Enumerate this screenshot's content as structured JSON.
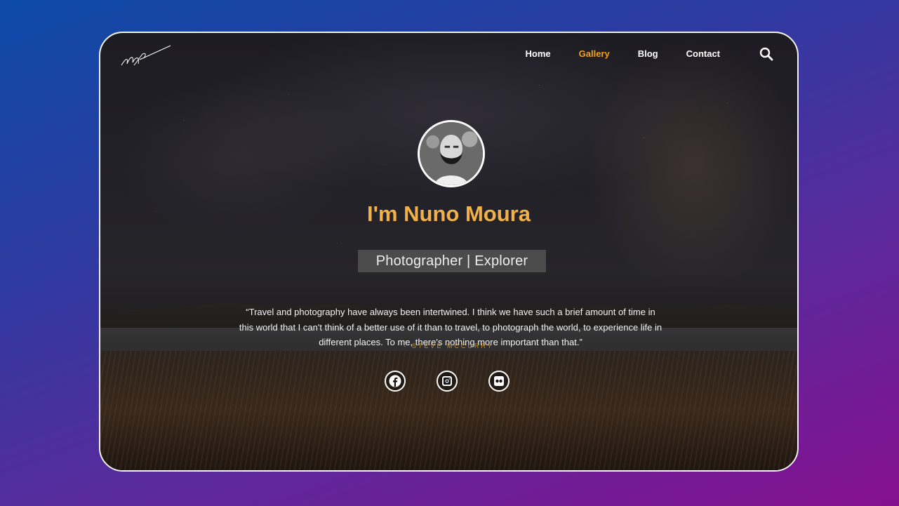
{
  "header": {
    "nav": [
      {
        "label": "Home",
        "active": false
      },
      {
        "label": "Gallery",
        "active": true
      },
      {
        "label": "Blog",
        "active": false
      },
      {
        "label": "Contact",
        "active": false
      }
    ],
    "search_icon": "search-icon",
    "logo": "signature-logo"
  },
  "hero": {
    "avatar": "profile-photo",
    "title": "I'm Nuno Moura",
    "subtitle": "Photographer | Explorer",
    "quote": "“Travel and photography have always been intertwined. I think we have such a brief amount of time in this world that I can't think of a better use of it than to travel, to photograph the world, to experience life in different places. To me, there's nothing more important than that.”",
    "author": "- STEVE MCCURRY"
  },
  "socials": [
    {
      "icon": "facebook-icon"
    },
    {
      "icon": "instagram-icon"
    },
    {
      "icon": "flickr-icon"
    }
  ],
  "colors": {
    "accent": "#f0a11e",
    "title": "#f0b14a",
    "author": "#c08a2a"
  }
}
